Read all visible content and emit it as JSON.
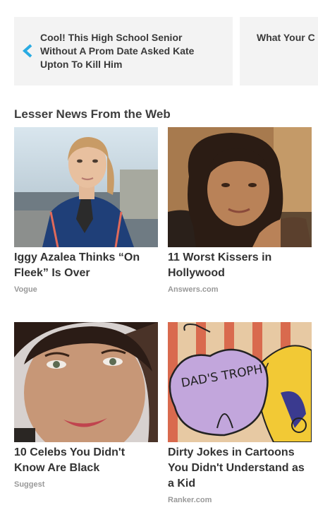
{
  "carousel": {
    "prev_title": "Cool! This High School Senior Without A Prom Date Asked Kate Upton To Kill Him",
    "next_title": "What Your C",
    "accent_color": "#29abe2"
  },
  "section": {
    "title": "Lesser News From the Web"
  },
  "stories": [
    {
      "headline": "Iggy Azalea Thinks “On Fleek” Is Over",
      "source": "Vogue"
    },
    {
      "headline": "11 Worst Kissers in Hollywood",
      "source": "Answers.com"
    },
    {
      "headline": "10 Celebs You Didn't Know Are Black",
      "source": "Suggest"
    },
    {
      "headline": "Dirty Jokes in Cartoons You Didn't Understand as a Kid",
      "source": "Ranker.com"
    }
  ],
  "icons": {
    "prev_arrow": "chevron-left-icon"
  }
}
